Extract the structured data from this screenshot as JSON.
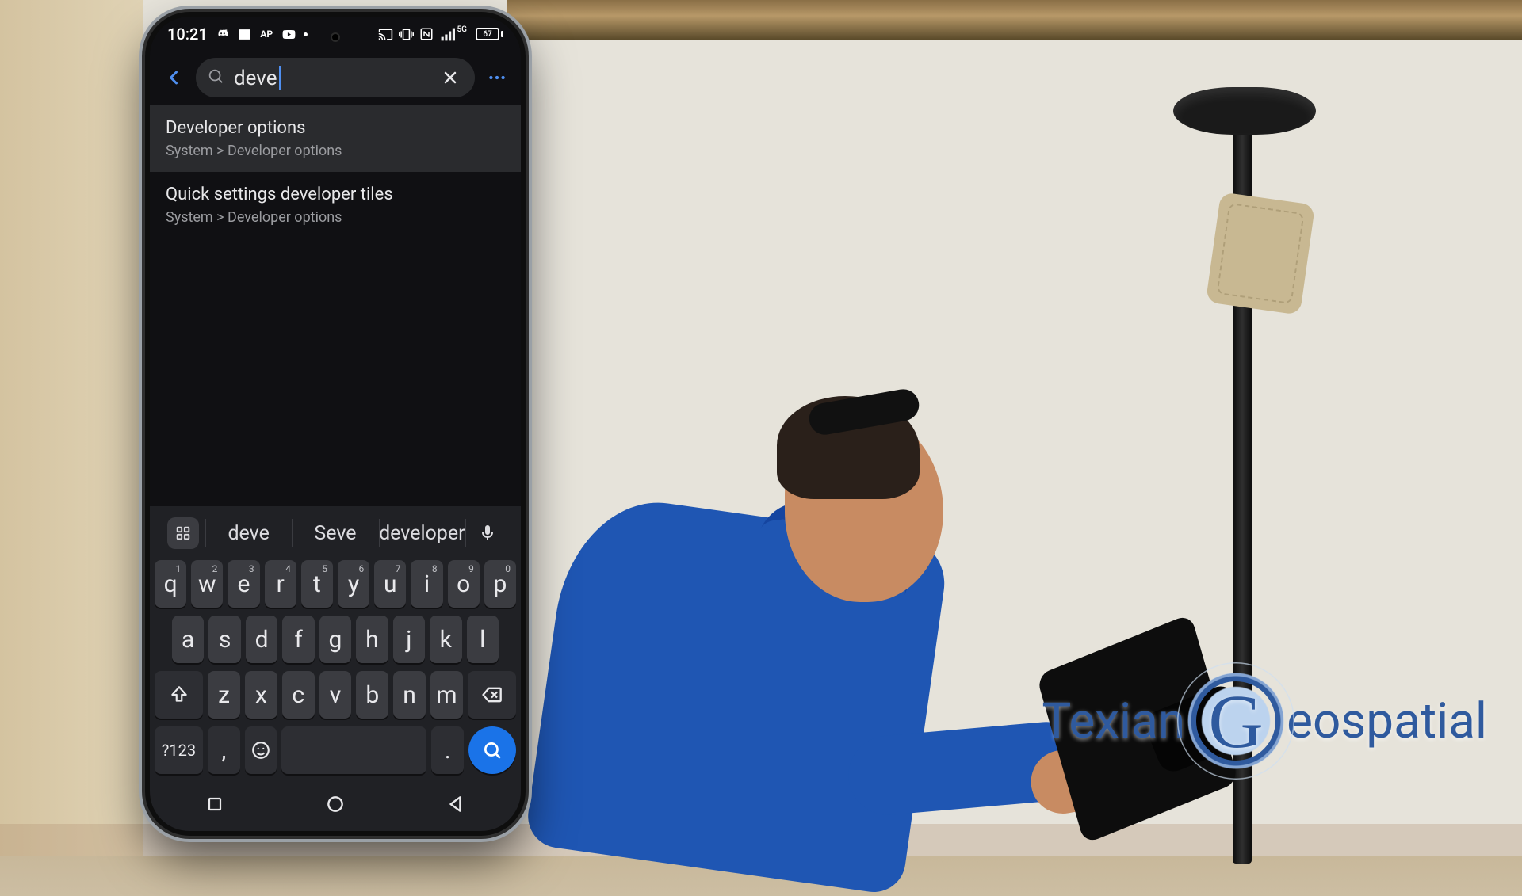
{
  "statusbar": {
    "time": "10:21",
    "battery_percent": "67"
  },
  "search": {
    "query": "deve"
  },
  "results": [
    {
      "title": "Developer options",
      "path": "System > Developer options"
    },
    {
      "title": "Quick settings developer tiles",
      "path": "System > Developer options"
    }
  ],
  "keyboard": {
    "suggestions": [
      "deve",
      "Seve",
      "developer"
    ],
    "row1": [
      {
        "k": "q",
        "n": "1"
      },
      {
        "k": "w",
        "n": "2"
      },
      {
        "k": "e",
        "n": "3"
      },
      {
        "k": "r",
        "n": "4"
      },
      {
        "k": "t",
        "n": "5"
      },
      {
        "k": "y",
        "n": "6"
      },
      {
        "k": "u",
        "n": "7"
      },
      {
        "k": "i",
        "n": "8"
      },
      {
        "k": "o",
        "n": "9"
      },
      {
        "k": "p",
        "n": "0"
      }
    ],
    "row2": [
      "a",
      "s",
      "d",
      "f",
      "g",
      "h",
      "j",
      "k",
      "l"
    ],
    "row3": [
      "z",
      "x",
      "c",
      "v",
      "b",
      "n",
      "m"
    ],
    "numeric_label": "?123",
    "comma": ",",
    "period": "."
  },
  "logo": {
    "word1": "Texian",
    "word2": "eospatial",
    "big_letter": "G"
  }
}
